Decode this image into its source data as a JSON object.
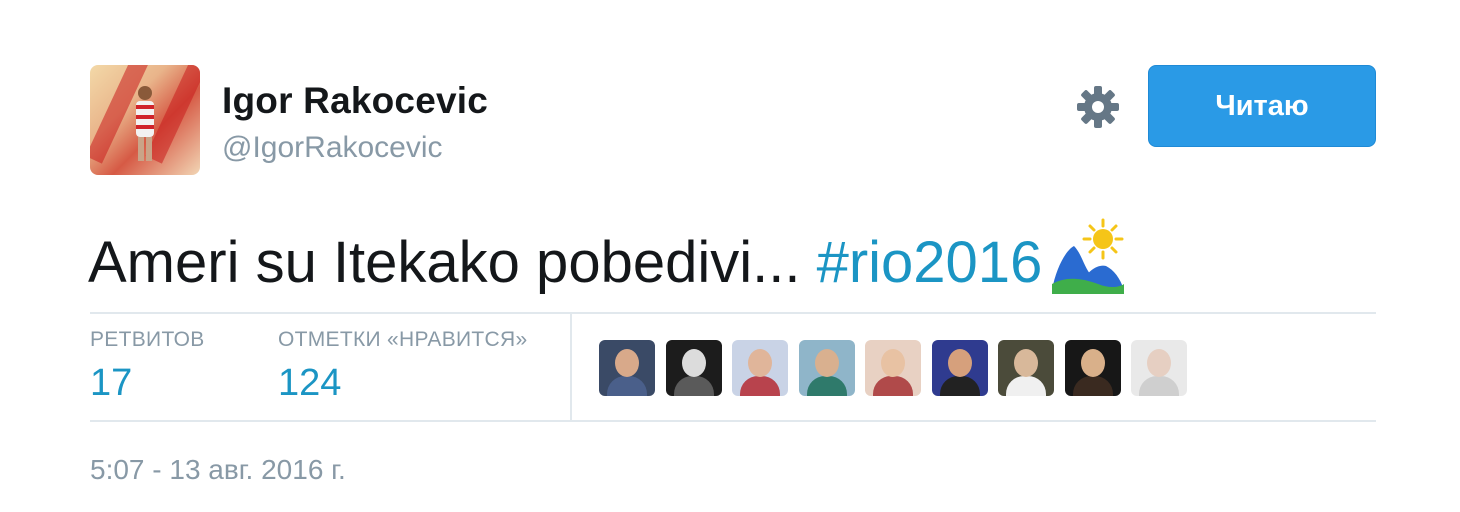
{
  "user": {
    "name": "Igor Rakocevic",
    "handle": "@IgorRakocevic",
    "avatar_icon": "profile-photo"
  },
  "actions": {
    "follow_label": "Читаю",
    "follow_color": "#2a9ae6",
    "settings_icon": "gear-icon"
  },
  "tweet": {
    "text": "Ameri su Itekako pobedivi... ",
    "hashtag": "#rio2016",
    "emoji": "rio-olympics-mountain-sun-emoji",
    "link_color": "#1b95c4"
  },
  "stats": {
    "retweets_label": "РЕТВИТОВ",
    "retweets_count": "17",
    "likes_label": "ОТМЕТКИ «НРАВИТСЯ»",
    "likes_count": "124"
  },
  "likers": [
    {
      "name": "liker-1",
      "bg": "#3a4a66",
      "skin": "#d8a98a",
      "shirt": "#4a5f8a"
    },
    {
      "name": "liker-2",
      "bg": "#1c1c1c",
      "skin": "#dcdcdc",
      "shirt": "#5a5a5a"
    },
    {
      "name": "liker-3",
      "bg": "#c9d3e6",
      "skin": "#e0b59a",
      "shirt": "#b8434d"
    },
    {
      "name": "liker-4",
      "bg": "#8fb5c9",
      "skin": "#d9b08f",
      "shirt": "#2f7a6b"
    },
    {
      "name": "liker-5",
      "bg": "#e8d1c3",
      "skin": "#e8c2a3",
      "shirt": "#b04a4a"
    },
    {
      "name": "liker-6",
      "bg": "#2f3b8f",
      "skin": "#d6a07c",
      "shirt": "#222222"
    },
    {
      "name": "liker-7",
      "bg": "#4b4b3a",
      "skin": "#d8b89a",
      "shirt": "#f0f0f0"
    },
    {
      "name": "liker-8",
      "bg": "#171717",
      "skin": "#d9b08a",
      "shirt": "#3a2a20"
    },
    {
      "name": "liker-9",
      "bg": "#e9e9e9",
      "skin": "#e6cfc2",
      "shirt": "#cfcfcf"
    }
  ],
  "meta": {
    "timestamp": "5:07 - 13 авг. 2016 г."
  }
}
